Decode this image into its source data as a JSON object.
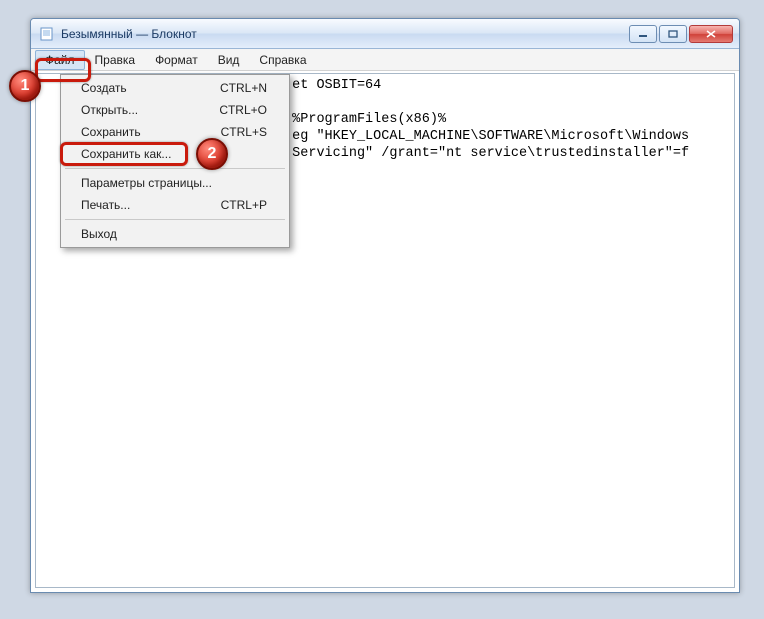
{
  "title": "Безымянный — Блокнот",
  "menus": {
    "file": "Файл",
    "edit": "Правка",
    "format": "Формат",
    "view": "Вид",
    "help": "Справка"
  },
  "file_menu": {
    "new": {
      "label": "Создать",
      "shortcut": "CTRL+N"
    },
    "open": {
      "label": "Открыть...",
      "shortcut": "CTRL+O"
    },
    "save": {
      "label": "Сохранить",
      "shortcut": "CTRL+S"
    },
    "save_as": {
      "label": "Сохранить как...",
      "shortcut": ""
    },
    "page_setup": {
      "label": "Параметры страницы...",
      "shortcut": ""
    },
    "print": {
      "label": "Печать...",
      "shortcut": "CTRL+P"
    },
    "exit": {
      "label": "Выход",
      "shortcut": ""
    }
  },
  "editor_text": "                               et OSBIT=64\n\n                               %ProgramFiles(x86)%\n                               eg \"HKEY_LOCAL_MACHINE\\SOFTWARE\\Microsoft\\Windows\n                               Servicing\" /grant=\"nt service\\trustedinstaller\"=f",
  "annotations": {
    "step1": "1",
    "step2": "2"
  }
}
